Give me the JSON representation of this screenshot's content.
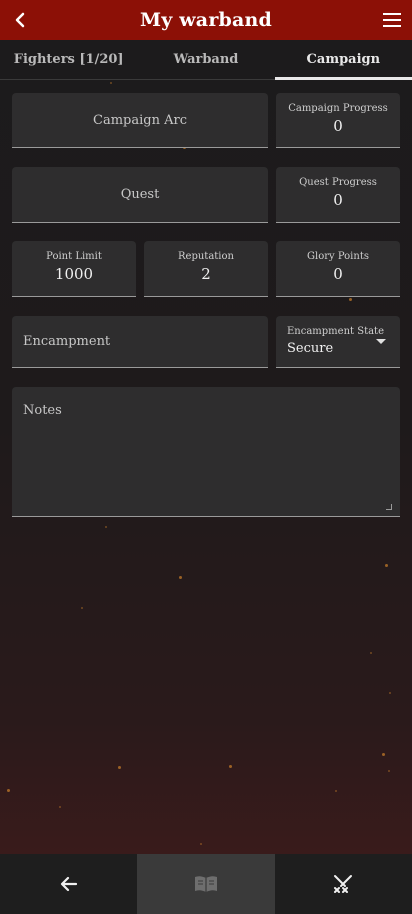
{
  "header": {
    "title": "My warband",
    "back_icon": "chevron-left-icon",
    "menu_icon": "hamburger-menu-icon"
  },
  "tabs": [
    {
      "label": "Fighters [1/20]",
      "active": false
    },
    {
      "label": "Warband",
      "active": false
    },
    {
      "label": "Campaign",
      "active": true
    }
  ],
  "campaign": {
    "arc_label": "Campaign Arc",
    "progress_label": "Campaign Progress",
    "progress_value": "0",
    "quest_label": "Quest",
    "quest_progress_label": "Quest Progress",
    "quest_progress_value": "0",
    "point_limit_label": "Point Limit",
    "point_limit_value": "1000",
    "reputation_label": "Reputation",
    "reputation_value": "2",
    "glory_label": "Glory Points",
    "glory_value": "0",
    "encampment_label": "Encampment",
    "encampment_state_label": "Encampment State",
    "encampment_state_value": "Secure",
    "notes_label": "Notes"
  },
  "bottom_nav": [
    {
      "icon": "arrow-left-icon",
      "active": false
    },
    {
      "icon": "book-icon",
      "active": true
    },
    {
      "icon": "crossed-swords-icon",
      "active": false
    }
  ],
  "colors": {
    "header": "#8c1006",
    "field_bg": "#2e2d2e",
    "accent_active_tab": "#e8e8e8"
  }
}
